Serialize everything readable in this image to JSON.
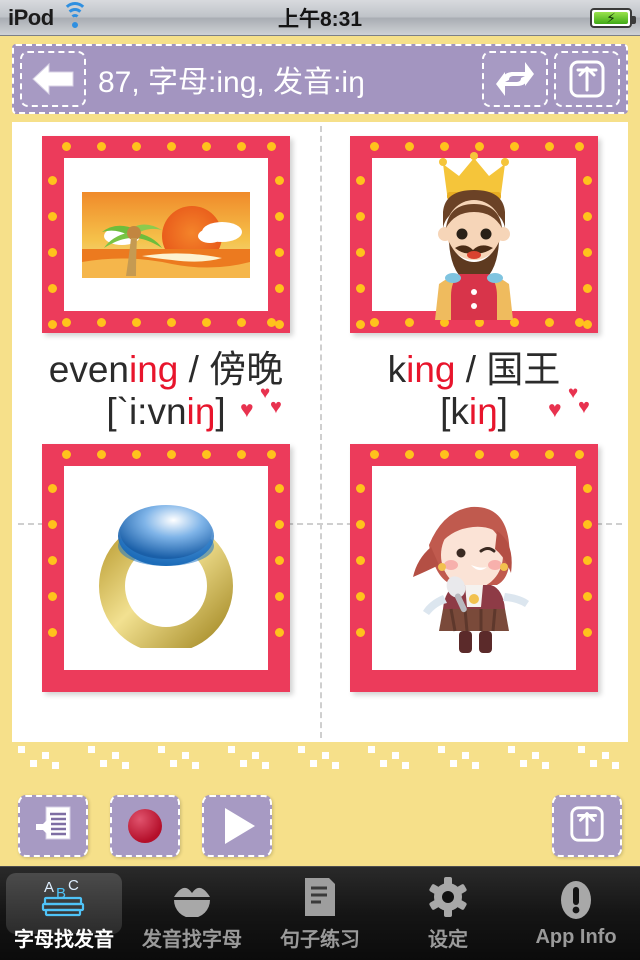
{
  "statusbar": {
    "carrier": "iPod",
    "wifi_icon": "wifi-icon",
    "time": "上午8:31",
    "battery_icon": "battery-charging-icon"
  },
  "header": {
    "back_icon": "arrow-left-icon",
    "title": "87, 字母:ing, 发音:iŋ",
    "shuffle_icon": "shuffle-arrows-icon",
    "export_icon": "export-box-icon",
    "bar_color": "#a395c0"
  },
  "cards": [
    {
      "image_name": "evening-sunset-illustration",
      "word_prefix": "even",
      "word_highlight": "ing",
      "word_separator": " / ",
      "translation": "傍晚",
      "phonetic_prefix": "[`i:vn",
      "phonetic_highlight": "iŋ",
      "phonetic_suffix": "]",
      "hearts": "♥♥♥"
    },
    {
      "image_name": "king-illustration",
      "word_prefix": "k",
      "word_highlight": "ing",
      "word_separator": " / ",
      "translation": "国王",
      "phonetic_prefix": "[k",
      "phonetic_highlight": "iŋ",
      "phonetic_suffix": "]",
      "hearts": "♥♥♥"
    },
    {
      "image_name": "ring-illustration",
      "word_prefix": "",
      "word_highlight": "",
      "word_separator": "",
      "translation": "",
      "phonetic_prefix": "",
      "phonetic_highlight": "",
      "phonetic_suffix": "",
      "hearts": ""
    },
    {
      "image_name": "singing-girl-illustration",
      "word_prefix": "",
      "word_highlight": "",
      "word_separator": "",
      "translation": "",
      "phonetic_prefix": "",
      "phonetic_highlight": "",
      "phonetic_suffix": "",
      "hearts": ""
    }
  ],
  "toolbar": {
    "read_icon": "speaker-document-icon",
    "record_icon": "record-dot-icon",
    "play_icon": "play-triangle-icon",
    "export_icon": "export-box-icon"
  },
  "tabbar": {
    "items": [
      {
        "label": "字母找发音",
        "icon": "abc-books-icon",
        "active": true
      },
      {
        "label": "发音找字母",
        "icon": "mouth-sound-icon",
        "active": false
      },
      {
        "label": "句子练习",
        "icon": "document-lines-icon",
        "active": false
      },
      {
        "label": "设定",
        "icon": "gear-icon",
        "active": false
      },
      {
        "label": "App Info",
        "icon": "info-exclamation-icon",
        "active": false
      }
    ]
  },
  "colors": {
    "page_bg": "#f6e08a",
    "header_purple": "#a395c0",
    "frame_pink": "#ec3b5b",
    "frame_dot_yellow": "#ffc21c",
    "highlight_red": "#e8152c",
    "heart_red": "#e8324f"
  }
}
